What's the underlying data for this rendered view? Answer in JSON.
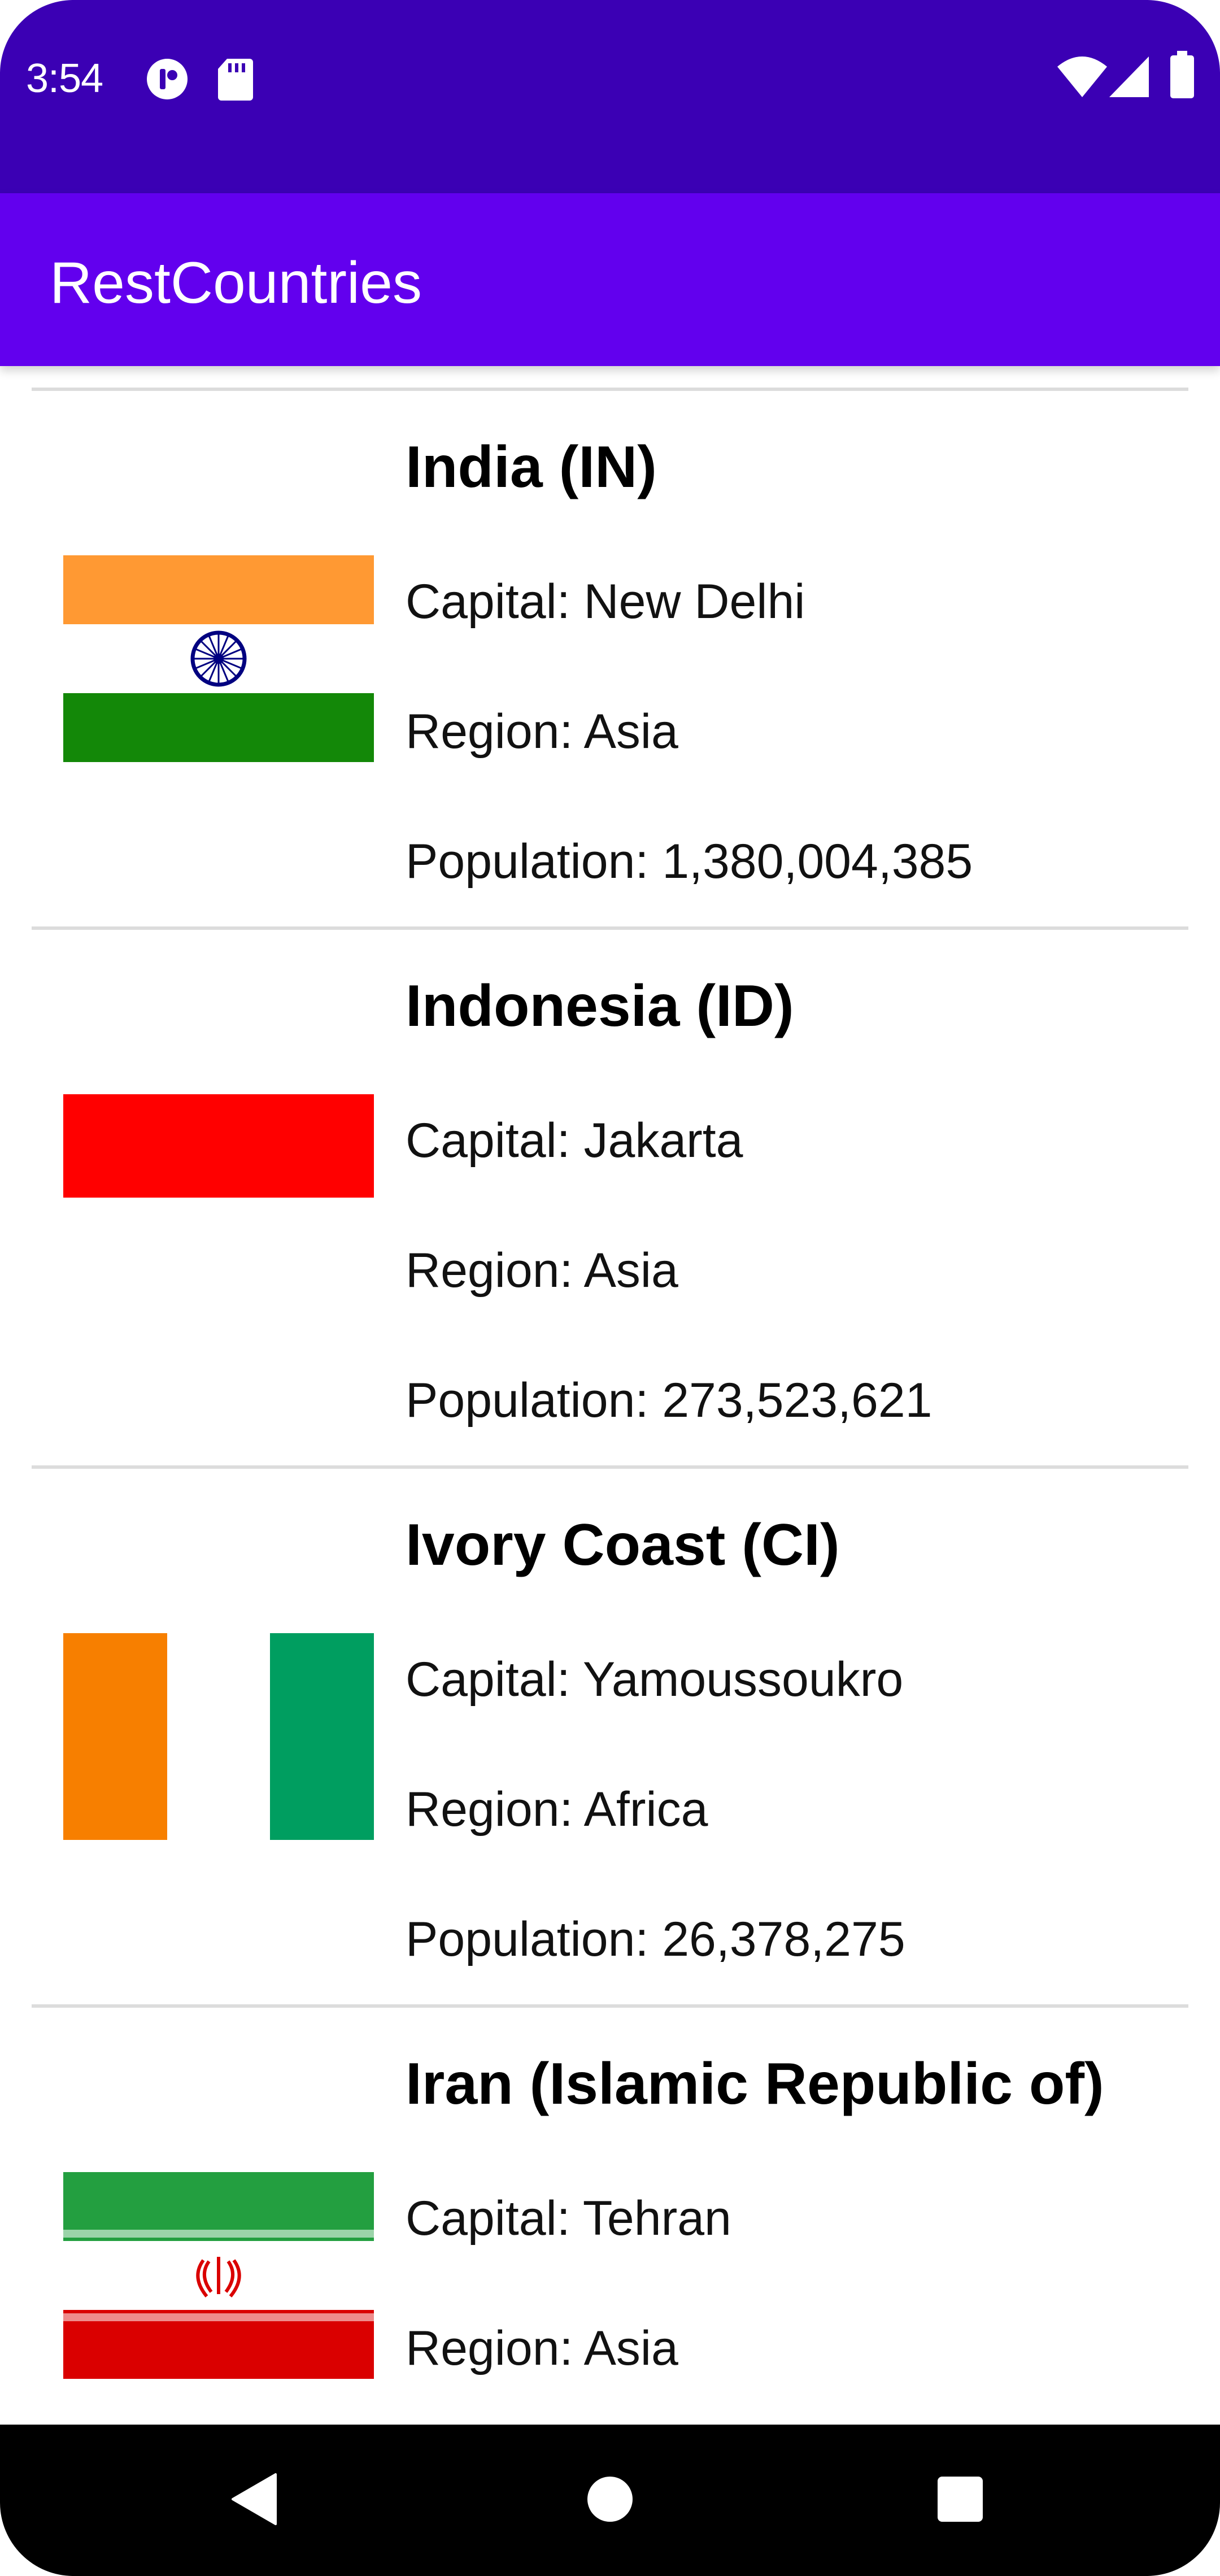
{
  "status_bar": {
    "time": "3:54",
    "icons_left": [
      "app-notification-icon",
      "sd-card-icon"
    ],
    "icons_right": [
      "wifi-icon",
      "cell-signal-icon",
      "battery-icon"
    ]
  },
  "app_bar": {
    "title": "RestCountries"
  },
  "countries": [
    {
      "name": "India (IN)",
      "capital": "Capital: New Delhi",
      "region": "Region: Asia",
      "population": "Population: 1,380,004,385",
      "flag": "india-flag-icon"
    },
    {
      "name": "Indonesia (ID)",
      "capital": "Capital: Jakarta",
      "region": "Region: Asia",
      "population": "Population: 273,523,621",
      "flag": "indonesia-flag-icon"
    },
    {
      "name": "Ivory Coast (CI)",
      "capital": "Capital: Yamoussoukro",
      "region": "Region: Africa",
      "population": "Population: 26,378,275",
      "flag": "ivory-coast-flag-icon"
    },
    {
      "name": "Iran (Islamic Republic of)",
      "capital": "Capital: Tehran",
      "region": "Region: Asia",
      "flag": "iran-flag-icon"
    }
  ],
  "nav_bar": {
    "buttons": [
      "back-icon",
      "home-icon",
      "recents-icon"
    ]
  },
  "colors": {
    "status_bar": "#3b00b4",
    "app_bar": "#6200ee",
    "nav_bar": "#000000"
  }
}
